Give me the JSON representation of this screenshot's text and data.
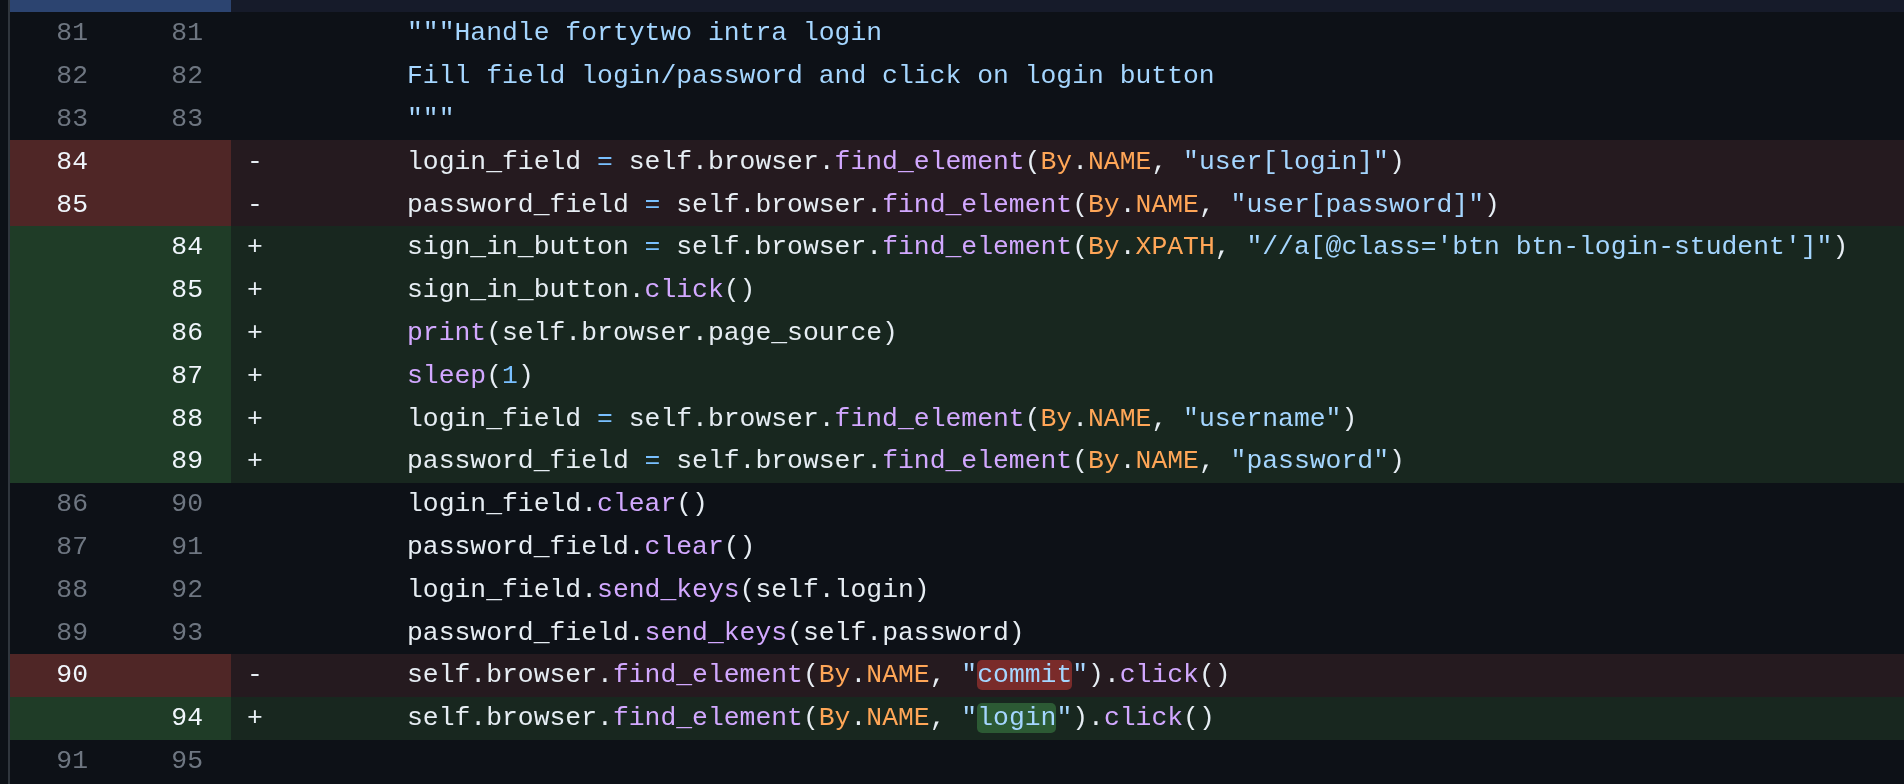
{
  "lines": [
    {
      "kind": "context",
      "old": "81",
      "new": "81",
      "tokens": [
        {
          "text": "\"\"\"Handle fortytwo intra login",
          "kind": "string"
        }
      ]
    },
    {
      "kind": "context",
      "old": "82",
      "new": "82",
      "tokens": [
        {
          "text": "Fill field login/password and click on login button",
          "kind": "string"
        }
      ]
    },
    {
      "kind": "context",
      "old": "83",
      "new": "83",
      "tokens": [
        {
          "text": "\"\"\"",
          "kind": "string"
        }
      ]
    },
    {
      "kind": "deletion",
      "old": "84",
      "marker": "-",
      "tokens": [
        {
          "text": "login_field ",
          "kind": "plain"
        },
        {
          "text": "=",
          "kind": "operator"
        },
        {
          "text": " self.browser.",
          "kind": "plain"
        },
        {
          "text": "find_element",
          "kind": "function"
        },
        {
          "text": "(",
          "kind": "plain"
        },
        {
          "text": "By",
          "kind": "constant"
        },
        {
          "text": ".",
          "kind": "plain"
        },
        {
          "text": "NAME",
          "kind": "constant"
        },
        {
          "text": ", ",
          "kind": "plain"
        },
        {
          "text": "\"user[login]\"",
          "kind": "string"
        },
        {
          "text": ")",
          "kind": "plain"
        }
      ]
    },
    {
      "kind": "deletion",
      "old": "85",
      "marker": "-",
      "tokens": [
        {
          "text": "password_field ",
          "kind": "plain"
        },
        {
          "text": "=",
          "kind": "operator"
        },
        {
          "text": " self.browser.",
          "kind": "plain"
        },
        {
          "text": "find_element",
          "kind": "function"
        },
        {
          "text": "(",
          "kind": "plain"
        },
        {
          "text": "By",
          "kind": "constant"
        },
        {
          "text": ".",
          "kind": "plain"
        },
        {
          "text": "NAME",
          "kind": "constant"
        },
        {
          "text": ", ",
          "kind": "plain"
        },
        {
          "text": "\"user[password]\"",
          "kind": "string"
        },
        {
          "text": ")",
          "kind": "plain"
        }
      ]
    },
    {
      "kind": "addition",
      "new": "84",
      "marker": "+",
      "tokens": [
        {
          "text": "sign_in_button ",
          "kind": "plain"
        },
        {
          "text": "=",
          "kind": "operator"
        },
        {
          "text": " self.browser.",
          "kind": "plain"
        },
        {
          "text": "find_element",
          "kind": "function"
        },
        {
          "text": "(",
          "kind": "plain"
        },
        {
          "text": "By",
          "kind": "constant"
        },
        {
          "text": ".",
          "kind": "plain"
        },
        {
          "text": "XPATH",
          "kind": "constant"
        },
        {
          "text": ", ",
          "kind": "plain"
        },
        {
          "text": "\"//a[@class='btn btn-login-student']\"",
          "kind": "string"
        },
        {
          "text": ")",
          "kind": "plain"
        }
      ]
    },
    {
      "kind": "addition",
      "new": "85",
      "marker": "+",
      "tokens": [
        {
          "text": "sign_in_button.",
          "kind": "plain"
        },
        {
          "text": "click",
          "kind": "function"
        },
        {
          "text": "()",
          "kind": "plain"
        }
      ]
    },
    {
      "kind": "addition",
      "new": "86",
      "marker": "+",
      "tokens": [
        {
          "text": "print",
          "kind": "function"
        },
        {
          "text": "(self.browser.page_source)",
          "kind": "plain"
        }
      ]
    },
    {
      "kind": "addition",
      "new": "87",
      "marker": "+",
      "tokens": [
        {
          "text": "sleep",
          "kind": "function"
        },
        {
          "text": "(",
          "kind": "plain"
        },
        {
          "text": "1",
          "kind": "number"
        },
        {
          "text": ")",
          "kind": "plain"
        }
      ]
    },
    {
      "kind": "addition",
      "new": "88",
      "marker": "+",
      "tokens": [
        {
          "text": "login_field ",
          "kind": "plain"
        },
        {
          "text": "=",
          "kind": "operator"
        },
        {
          "text": " self.browser.",
          "kind": "plain"
        },
        {
          "text": "find_element",
          "kind": "function"
        },
        {
          "text": "(",
          "kind": "plain"
        },
        {
          "text": "By",
          "kind": "constant"
        },
        {
          "text": ".",
          "kind": "plain"
        },
        {
          "text": "NAME",
          "kind": "constant"
        },
        {
          "text": ", ",
          "kind": "plain"
        },
        {
          "text": "\"username\"",
          "kind": "string"
        },
        {
          "text": ")",
          "kind": "plain"
        }
      ]
    },
    {
      "kind": "addition",
      "new": "89",
      "marker": "+",
      "tokens": [
        {
          "text": "password_field ",
          "kind": "plain"
        },
        {
          "text": "=",
          "kind": "operator"
        },
        {
          "text": " self.browser.",
          "kind": "plain"
        },
        {
          "text": "find_element",
          "kind": "function"
        },
        {
          "text": "(",
          "kind": "plain"
        },
        {
          "text": "By",
          "kind": "constant"
        },
        {
          "text": ".",
          "kind": "plain"
        },
        {
          "text": "NAME",
          "kind": "constant"
        },
        {
          "text": ", ",
          "kind": "plain"
        },
        {
          "text": "\"password\"",
          "kind": "string"
        },
        {
          "text": ")",
          "kind": "plain"
        }
      ]
    },
    {
      "kind": "context",
      "old": "86",
      "new": "90",
      "tokens": [
        {
          "text": "login_field.",
          "kind": "plain"
        },
        {
          "text": "clear",
          "kind": "function"
        },
        {
          "text": "()",
          "kind": "plain"
        }
      ]
    },
    {
      "kind": "context",
      "old": "87",
      "new": "91",
      "tokens": [
        {
          "text": "password_field.",
          "kind": "plain"
        },
        {
          "text": "clear",
          "kind": "function"
        },
        {
          "text": "()",
          "kind": "plain"
        }
      ]
    },
    {
      "kind": "context",
      "old": "88",
      "new": "92",
      "tokens": [
        {
          "text": "login_field.",
          "kind": "plain"
        },
        {
          "text": "send_keys",
          "kind": "function"
        },
        {
          "text": "(self.login)",
          "kind": "plain"
        }
      ]
    },
    {
      "kind": "context",
      "old": "89",
      "new": "93",
      "tokens": [
        {
          "text": "password_field.",
          "kind": "plain"
        },
        {
          "text": "send_keys",
          "kind": "function"
        },
        {
          "text": "(self.password)",
          "kind": "plain"
        }
      ]
    },
    {
      "kind": "deletion",
      "old": "90",
      "marker": "-",
      "tokens": [
        {
          "text": "self.browser.",
          "kind": "plain"
        },
        {
          "text": "find_element",
          "kind": "function"
        },
        {
          "text": "(",
          "kind": "plain"
        },
        {
          "text": "By",
          "kind": "constant"
        },
        {
          "text": ".",
          "kind": "plain"
        },
        {
          "text": "NAME",
          "kind": "constant"
        },
        {
          "text": ", ",
          "kind": "plain"
        },
        {
          "text": "\"",
          "kind": "string"
        },
        {
          "text": "commit",
          "kind": "string",
          "emphasized": true
        },
        {
          "text": "\"",
          "kind": "string"
        },
        {
          "text": ").",
          "kind": "plain"
        },
        {
          "text": "click",
          "kind": "function"
        },
        {
          "text": "()",
          "kind": "plain"
        }
      ]
    },
    {
      "kind": "addition",
      "new": "94",
      "marker": "+",
      "tokens": [
        {
          "text": "self.browser.",
          "kind": "plain"
        },
        {
          "text": "find_element",
          "kind": "function"
        },
        {
          "text": "(",
          "kind": "plain"
        },
        {
          "text": "By",
          "kind": "constant"
        },
        {
          "text": ".",
          "kind": "plain"
        },
        {
          "text": "NAME",
          "kind": "constant"
        },
        {
          "text": ", ",
          "kind": "plain"
        },
        {
          "text": "\"",
          "kind": "string"
        },
        {
          "text": "login",
          "kind": "string",
          "emphasized": true
        },
        {
          "text": "\"",
          "kind": "string"
        },
        {
          "text": ").",
          "kind": "plain"
        },
        {
          "text": "click",
          "kind": "function"
        },
        {
          "text": "()",
          "kind": "plain"
        }
      ]
    },
    {
      "kind": "context",
      "old": "91",
      "new": "95"
    }
  ]
}
